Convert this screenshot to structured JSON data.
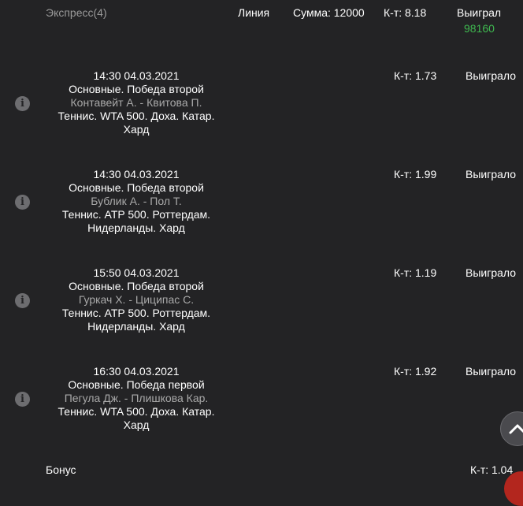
{
  "header": {
    "type": "Экспресс(4)",
    "mode": "Линия",
    "amount": "Сумма: 12000",
    "coef": "К-т: 8.18",
    "status": "Выиграл",
    "win": "98160"
  },
  "bets": [
    {
      "datetime": "14:30 04.03.2021",
      "market": "Основные. Победа второй",
      "teams": "Контавейт А. - Квитова П.",
      "league": "Теннис. WTA 500. Доха. Катар.",
      "surface": "Хард",
      "coef": "К-т: 1.73",
      "result": "Выиграло"
    },
    {
      "datetime": "14:30 04.03.2021",
      "market": "Основные. Победа второй",
      "teams": "Бублик А. - Пол Т.",
      "league": "Теннис. ATP 500. Роттердам.",
      "surface": "Нидерланды. Хард",
      "coef": "К-т: 1.99",
      "result": "Выиграло"
    },
    {
      "datetime": "15:50 04.03.2021",
      "market": "Основные. Победа второй",
      "teams": "Гуркач Х. - Циципас С.",
      "league": "Теннис. ATP 500. Роттердам.",
      "surface": "Нидерланды. Хард",
      "coef": "К-т: 1.19",
      "result": "Выиграло"
    },
    {
      "datetime": "16:30 04.03.2021",
      "market": "Основные. Победа первой",
      "teams": "Пегула Дж. - Плишкова Кар.",
      "league": "Теннис. WTA 500. Доха. Катар.",
      "surface": "Хард",
      "coef": "К-т: 1.92",
      "result": "Выиграло"
    }
  ],
  "bonus": {
    "label": "Бонус",
    "coef": "К-т: 1.04"
  },
  "icons": {
    "info": "info-icon",
    "scroll_up": "chevron-up-icon"
  },
  "colors": {
    "background": "#232325",
    "win_green": "#3fb950"
  }
}
